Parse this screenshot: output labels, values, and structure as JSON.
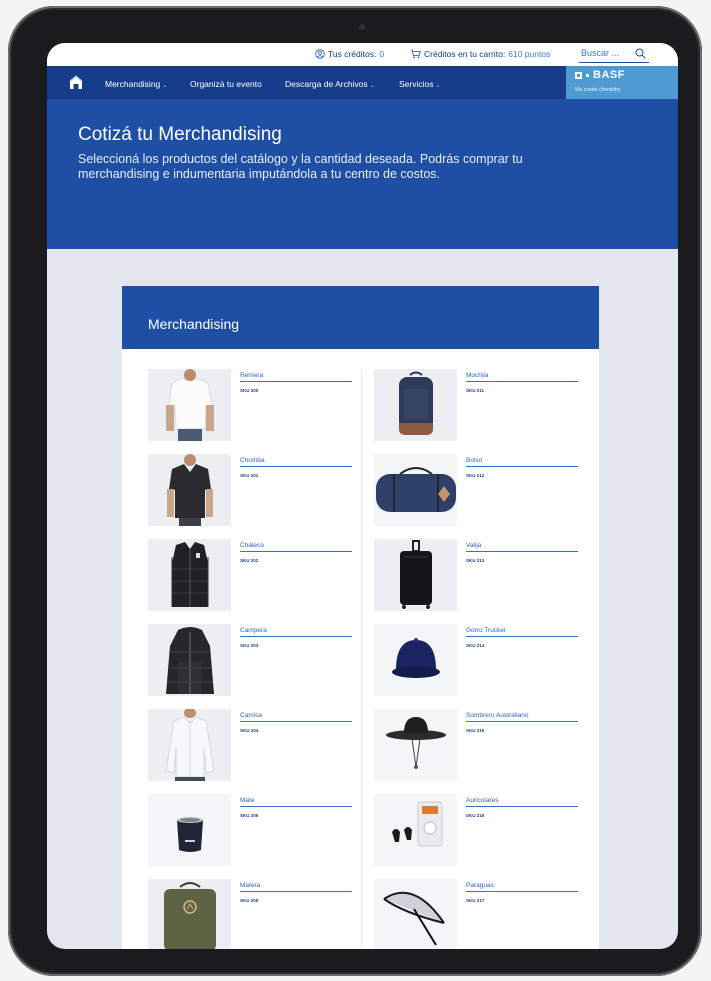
{
  "utility": {
    "credits_label": "Tus créditos:",
    "credits_value": "0",
    "cart_label": "Créditos en tu carrito:",
    "cart_value": "610 puntos",
    "search_placeholder": "Buscar ..."
  },
  "nav": {
    "items": [
      {
        "label": "Merchandising",
        "dropdown": "⌄"
      },
      {
        "label": "Organizá tu evento"
      },
      {
        "label": "Descarga de Archivos",
        "dropdown": "⌄"
      },
      {
        "label": "Servicios",
        "dropdown": "⌄"
      }
    ]
  },
  "brand": {
    "name": "BASF",
    "tagline": "We create chemistry",
    "color": "#4d9bd3"
  },
  "hero": {
    "title": "Cotizá tu Merchandising",
    "description": "Seleccioná los productos del catálogo y la cantidad deseada. Podrás comprar tu merchandising e indumentaria imputándola a tu centro de costos."
  },
  "section": {
    "title": "Merchandising"
  },
  "products_left": [
    {
      "name": "Remera",
      "sku": "SKU 200",
      "icon": "tshirt-white"
    },
    {
      "name": "Chomba",
      "sku": "SKU 201",
      "icon": "polo-dark"
    },
    {
      "name": "Chaleco",
      "sku": "SKU 202",
      "icon": "vest-black"
    },
    {
      "name": "Campera",
      "sku": "SKU 203",
      "icon": "jacket-black"
    },
    {
      "name": "Camisa",
      "sku": "SKU 204",
      "icon": "shirt-white"
    },
    {
      "name": "Mate",
      "sku": "SKU 205",
      "icon": "mate-cup"
    },
    {
      "name": "Matera",
      "sku": "SKU 206",
      "icon": "mate-bag"
    }
  ],
  "products_right": [
    {
      "name": "Mochila",
      "sku": "SKU 211",
      "icon": "backpack"
    },
    {
      "name": "Bolso",
      "sku": "SKU 212",
      "icon": "duffel-bag"
    },
    {
      "name": "Valija",
      "sku": "SKU 213",
      "icon": "suitcase"
    },
    {
      "name": "Gorro Trucker",
      "sku": "SKU 214",
      "icon": "trucker-cap"
    },
    {
      "name": "Sombrero Australiano",
      "sku": "SKU 215",
      "icon": "bucket-hat"
    },
    {
      "name": "Auriculares",
      "sku": "SKU 216",
      "icon": "earbuds"
    },
    {
      "name": "Paraguas",
      "sku": "SKU 217",
      "icon": "umbrella"
    }
  ],
  "colors": {
    "primary": "#1f4ea5",
    "nav": "#173d8a",
    "page_bg": "#e3e6ee"
  }
}
